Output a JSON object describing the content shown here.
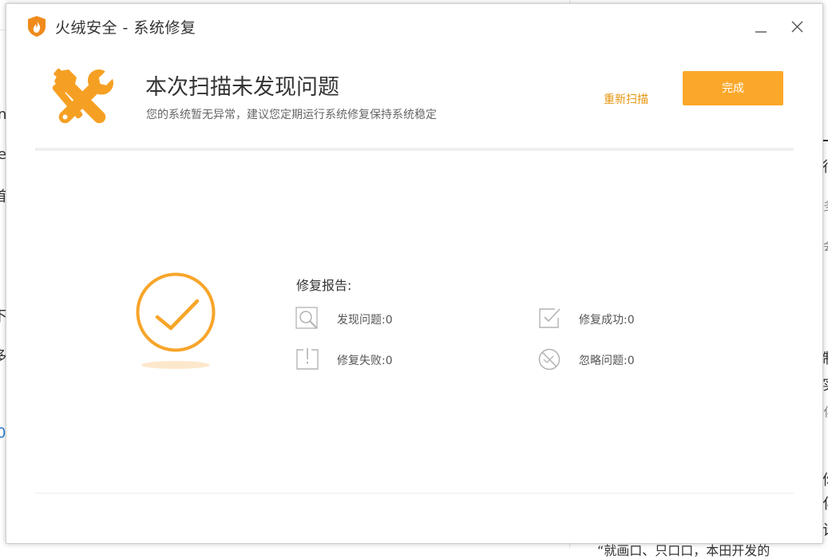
{
  "window": {
    "title": "火绒安全 - 系统修复"
  },
  "header": {
    "headline": "本次扫描未发现问题",
    "subline": "您的系统暂无异常，建议您定期运行系统修复保持系统稳定",
    "rescan_label": "重新扫描",
    "done_label": "完成"
  },
  "report": {
    "title": "修复报告:",
    "stats": [
      {
        "label": "发现问题:0",
        "icon": "search-icon"
      },
      {
        "label": "修复成功:0",
        "icon": "check-box-icon"
      },
      {
        "label": "修复失败:0",
        "icon": "warning-box-icon"
      },
      {
        "label": "忽略问题:0",
        "icon": "ignore-icon"
      }
    ]
  },
  "background_fragments": {
    "left": [
      "n",
      "e",
      "首",
      "下",
      "多",
      "0"
    ],
    "right": [
      "行",
      "多",
      "会",
      "制",
      "实",
      "化",
      "你",
      "化",
      "计"
    ],
    "bottom": "“就画口、只口口，本田开发的"
  },
  "colors": {
    "accent": "#fba82a",
    "accent_text": "#e5960f",
    "icon_gray": "#b3b3b3"
  }
}
